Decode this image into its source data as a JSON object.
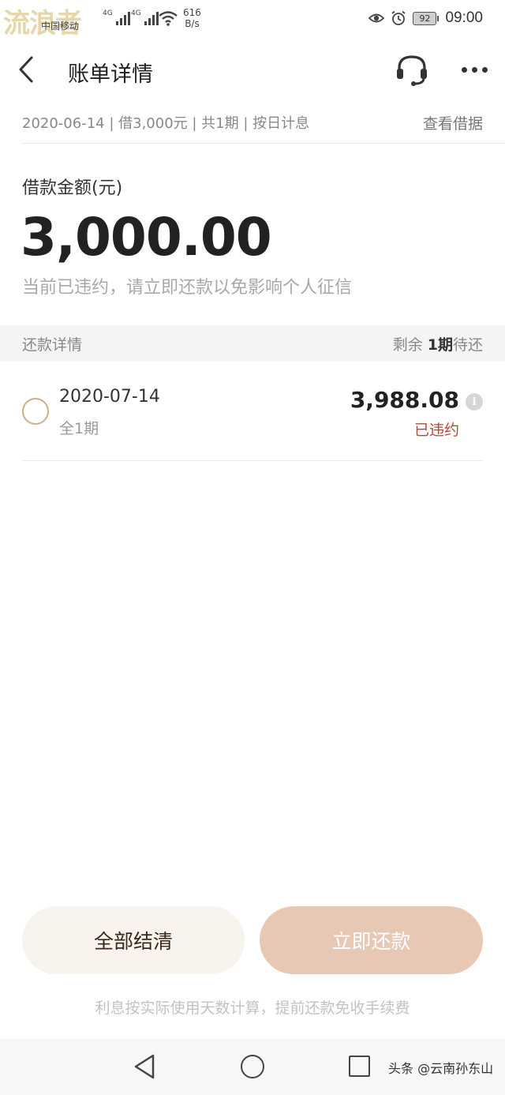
{
  "status_bar": {
    "watermark": "流浪者",
    "carrier": "中国移动",
    "network_tag_1": "4G",
    "network_tag_2": "4G",
    "speed_value": "616",
    "speed_unit": "B/s",
    "battery": "92",
    "time": "09:00"
  },
  "header": {
    "title": "账单详情",
    "back_icon": "chevron-left-icon",
    "service_icon": "headset-icon",
    "more_icon": "more-dots-icon"
  },
  "loan_info": {
    "summary": "2020-06-14 | 借3,000元 | 共1期 | 按日计息",
    "view_receipt": "查看借据"
  },
  "amount": {
    "label": "借款金额(元)",
    "value": "3,000.00",
    "warning": "当前已违约，请立即还款以免影响个人征信"
  },
  "repay_section": {
    "title": "还款详情",
    "remaining_prefix": "剩余 ",
    "remaining_count": "1期",
    "remaining_suffix": "待还"
  },
  "repay_items": [
    {
      "date": "2020-07-14",
      "period": "全1期",
      "amount": "3,988.08",
      "status": "已违约"
    }
  ],
  "actions": {
    "settle_all": "全部结清",
    "repay_now": "立即还款"
  },
  "footnote": "利息按实际使用天数计算，提前还款免收手续费",
  "credit": "头条 @云南孙东山",
  "colors": {
    "accent": "#e6c8b4",
    "status_overdue": "#b04a38",
    "radio_border": "#cfae8a"
  }
}
